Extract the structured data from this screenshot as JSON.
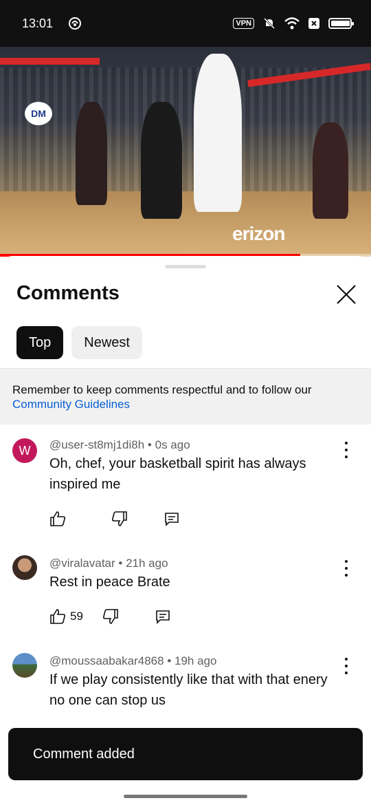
{
  "status_bar": {
    "time": "13:01",
    "vpn_label": "VPN",
    "icons": [
      "headset-icon",
      "mute-icon",
      "wifi-icon",
      "sim-x-icon",
      "battery-icon"
    ]
  },
  "video": {
    "logo_text": "DM",
    "sponsor_text": "erizon",
    "progress": 0.81,
    "accent": "#ff0000"
  },
  "sheet": {
    "title": "Comments",
    "tabs": [
      {
        "label": "Top",
        "active": true
      },
      {
        "label": "Newest",
        "active": false
      }
    ],
    "notice": {
      "text": "Remember to keep comments respectful and to follow our",
      "link": "Community Guidelines"
    }
  },
  "comments": [
    {
      "author": "@user-st8mj1di8h",
      "time": "0s ago",
      "avatar_letter": "W",
      "text": "Oh, chef, your basketball spirit has always inspired me",
      "likes": ""
    },
    {
      "author": "@viralavatar",
      "time": "21h ago",
      "text": "Rest in peace Brate",
      "likes": "59"
    },
    {
      "author": "@moussaabakar4868",
      "time": "19h ago",
      "text": "If we play consistently like that with that enery no one can stop us",
      "likes": ""
    }
  ],
  "toast": {
    "text": "Comment added"
  },
  "colors": {
    "link": "#065fd4",
    "avatar_letter_bg": "#c2185b",
    "chip_active": "#0f0f0f"
  }
}
